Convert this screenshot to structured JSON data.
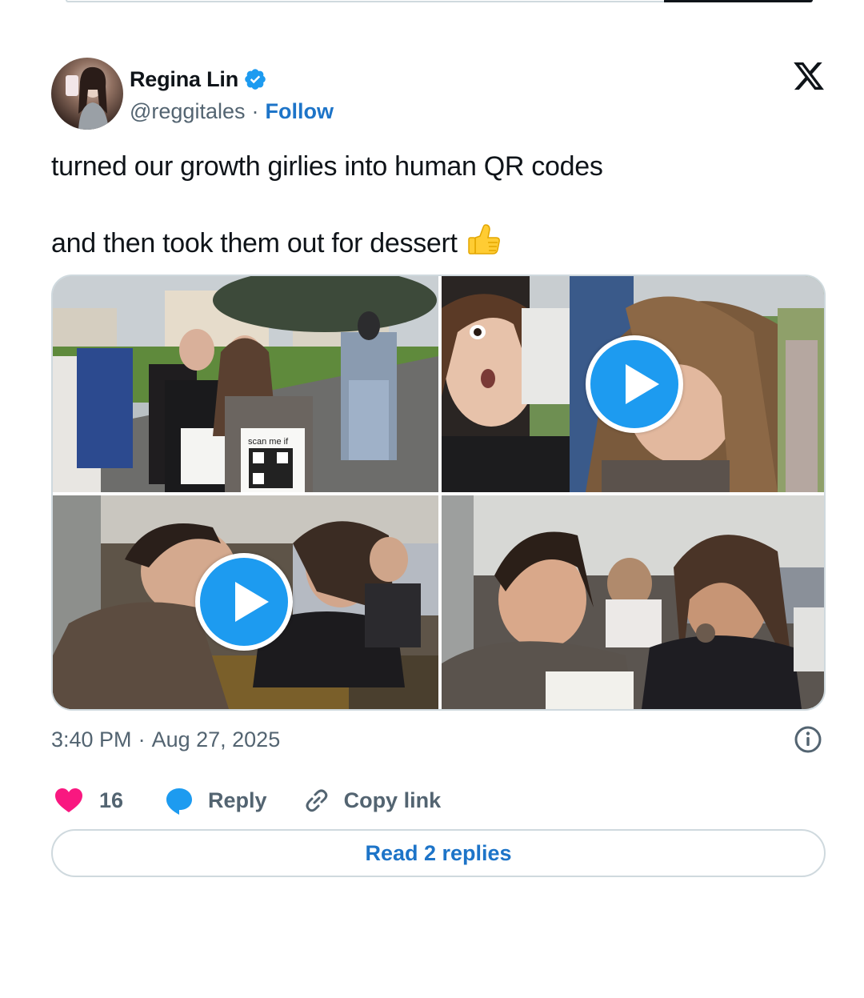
{
  "author": {
    "name": "Regina Lin",
    "handle": "@reggitales",
    "separator": "·",
    "follow_label": "Follow",
    "verified": true
  },
  "tweet": {
    "lines": [
      "turned our growth girlies into human QR codes",
      "and then took them out for dessert"
    ],
    "emoji": "thumbs-up"
  },
  "media": {
    "tiles": [
      {
        "kind": "photo",
        "qr_sign_text": "scan me if"
      },
      {
        "kind": "video"
      },
      {
        "kind": "video"
      },
      {
        "kind": "photo"
      }
    ]
  },
  "meta": {
    "time": "3:40 PM",
    "separator": "·",
    "date": "Aug 27, 2025"
  },
  "actions": {
    "like_count": "16",
    "reply_label": "Reply",
    "copy_label": "Copy link"
  },
  "read_replies_label": "Read 2 replies",
  "colors": {
    "accent": "#1d9bf0",
    "link": "#1d74c8",
    "like": "#f91880",
    "muted": "#536471",
    "border": "#cfd9de"
  }
}
